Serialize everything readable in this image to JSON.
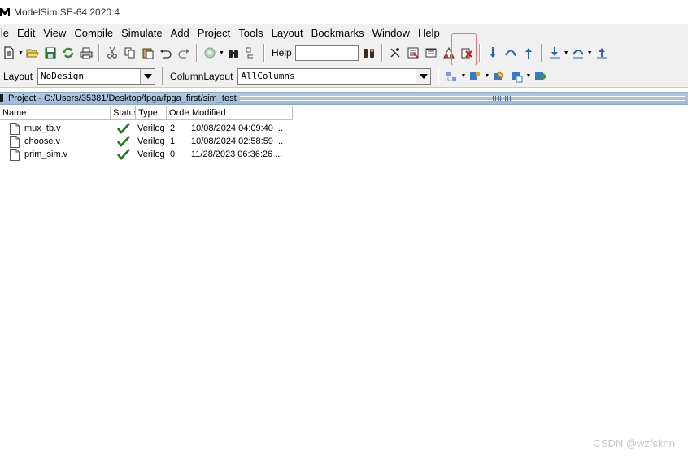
{
  "window": {
    "title": "ModelSim SE-64 2020.4"
  },
  "menu": [
    "ile",
    "Edit",
    "View",
    "Compile",
    "Simulate",
    "Add",
    "Project",
    "Tools",
    "Layout",
    "Bookmarks",
    "Window",
    "Help"
  ],
  "toolbar": {
    "help_label": "Help",
    "help_value": "",
    "layout_label": "Layout",
    "layout_value": "NoDesign",
    "column_layout_label": "ColumnLayout",
    "column_layout_value": "AllColumns"
  },
  "project": {
    "title": "Project - C:/Users/35381/Desktop/fpga/fpga_first/sim_test",
    "columns": {
      "name": "Name",
      "status": "Status",
      "type": "Type",
      "order": "Order",
      "modified": "Modified"
    },
    "files": [
      {
        "name": "mux_tb.v",
        "status": "checkmark-icon",
        "type": "Verilog",
        "order": "2",
        "modified": "10/08/2024 04:09:40 ..."
      },
      {
        "name": "choose.v",
        "status": "checkmark-icon",
        "type": "Verilog",
        "order": "1",
        "modified": "10/08/2024 02:58:59 ..."
      },
      {
        "name": "prim_sim.v",
        "status": "checkmark-icon",
        "type": "Verilog",
        "order": "0",
        "modified": "11/28/2023 06:36:26 ..."
      }
    ]
  },
  "watermark": "CSDN @wzfsknn",
  "colors": {
    "panel_header": "#b3cbe3",
    "status_ok": "#1a7a1a",
    "highlight": "#e87878"
  }
}
